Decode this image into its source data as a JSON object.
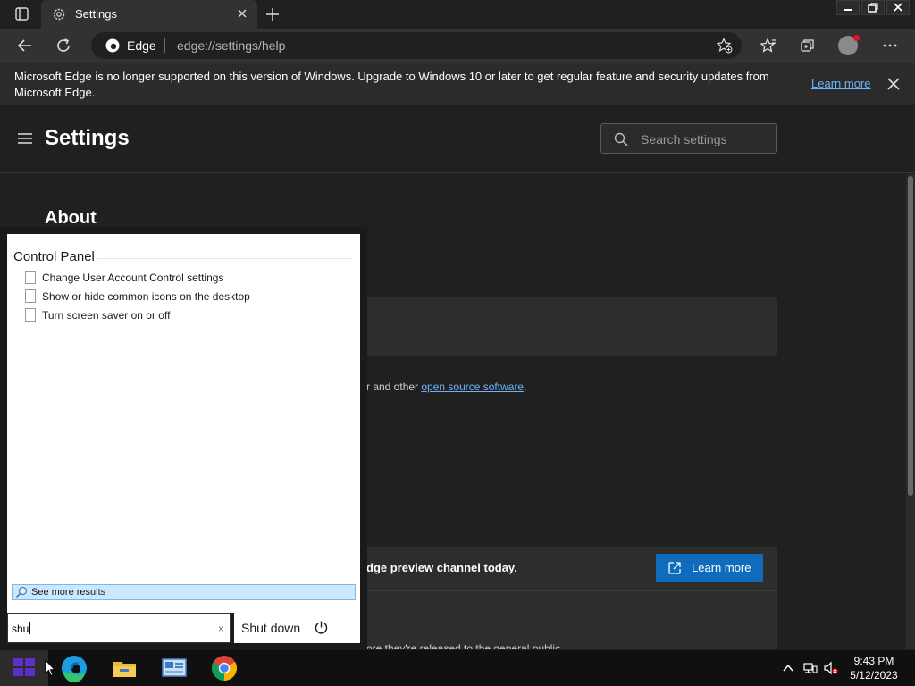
{
  "browser": {
    "tab_title": "Settings",
    "omnibox_brand": "Edge",
    "url": "edge://settings/help"
  },
  "infobar": {
    "message": "Microsoft Edge is no longer supported on this version of Windows. Upgrade to Windows 10 or later to get regular feature and security updates from Microsoft Edge.",
    "learn_more": "Learn more"
  },
  "settings": {
    "title": "Settings",
    "search_placeholder": "Search settings",
    "section_title": "About",
    "oss_prefix": "r and other ",
    "oss_link": "open source software",
    "oss_suffix": ".",
    "preview_text": "dge preview channel today.",
    "preview_button": "Learn more",
    "footer_text": "ore they're released to the general public."
  },
  "start_menu": {
    "group_title": "Control Panel",
    "results": [
      "Change User Account Control settings",
      "Show or hide common icons on the desktop",
      "Turn screen saver on or off"
    ],
    "see_more": "See more results",
    "search_value": "shu",
    "clear_glyph": "×",
    "shutdown_label": "Shut down"
  },
  "taskbar": {
    "time": "9:43 PM",
    "date": "5/12/2023",
    "apps": [
      "edge-icon",
      "file-explorer-icon",
      "control-panel-icon",
      "chrome-icon"
    ]
  },
  "colors": {
    "accent": "#0f6cbd",
    "link": "#6cb4f5",
    "see_more_highlight": "#cce8ff"
  }
}
